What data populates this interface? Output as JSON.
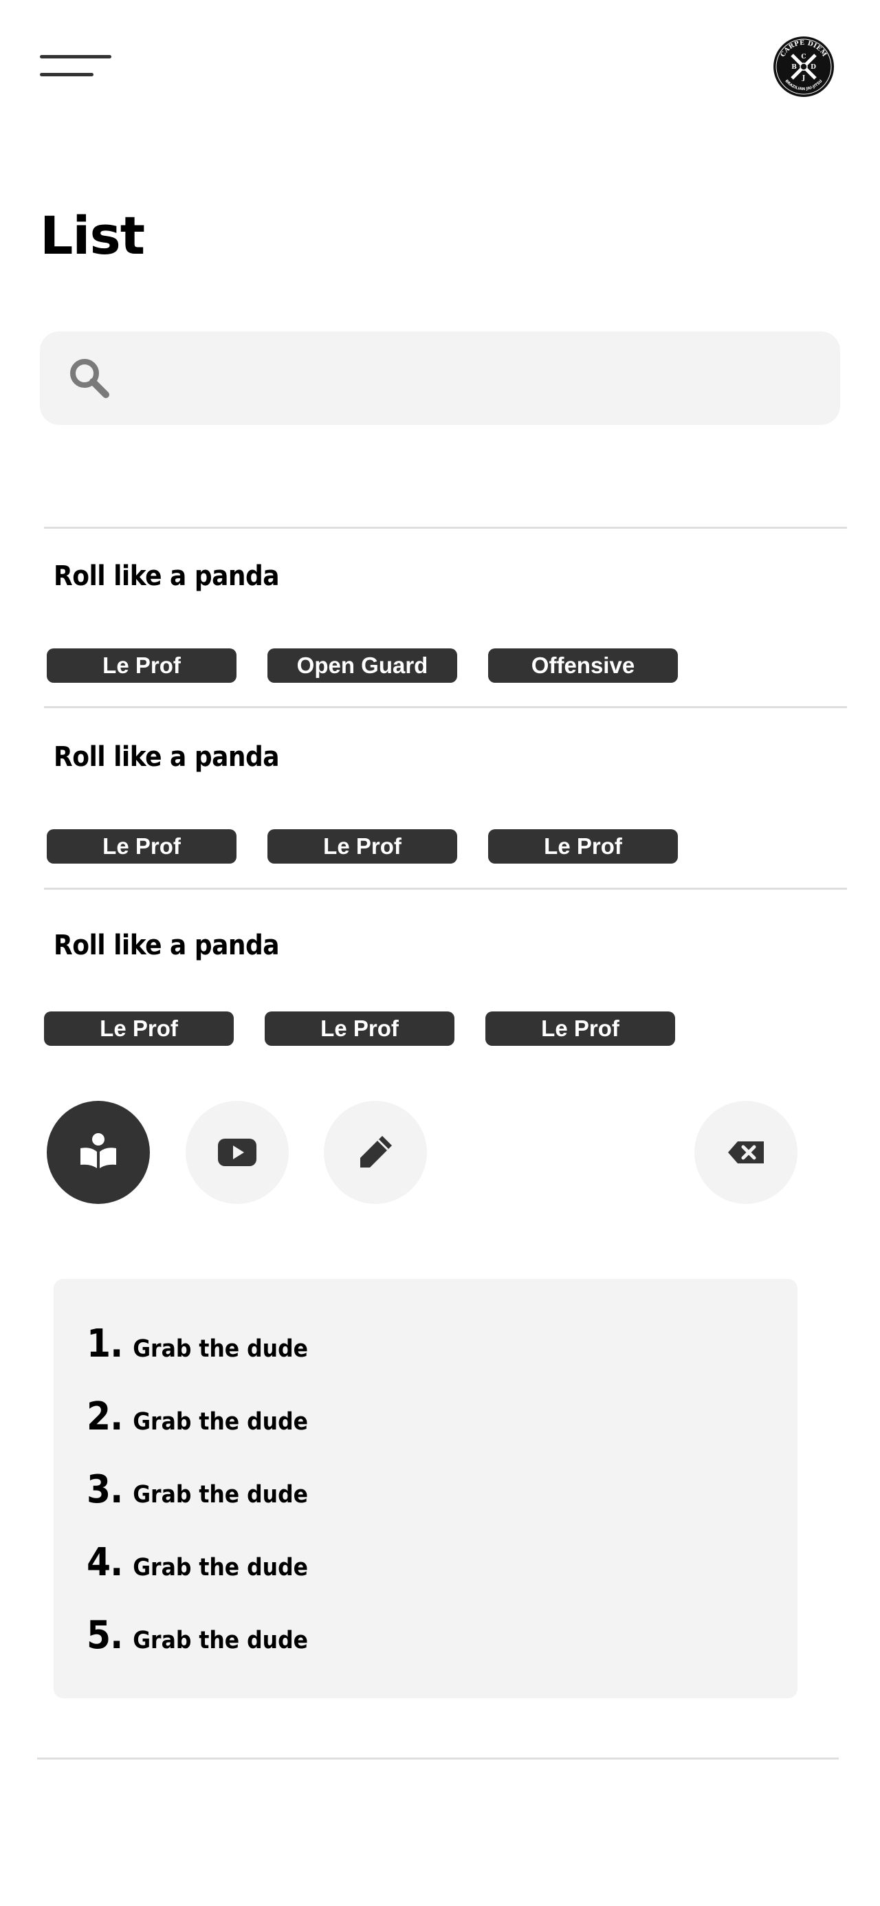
{
  "header": {
    "menu_icon": "hamburger-menu-icon",
    "logo": {
      "name": "carpe-diem-logo",
      "top_text": "CARPE DIEM",
      "bottom_text": "BRAZILIAN JIU-JITSU",
      "letters": [
        "C",
        "B",
        "D",
        "J"
      ]
    }
  },
  "page": {
    "title": "List"
  },
  "search": {
    "icon": "search-icon",
    "value": "",
    "placeholder": ""
  },
  "items": [
    {
      "title": "Roll like a panda",
      "tags": [
        "Le Prof",
        "Open Guard",
        "Offensive"
      ]
    },
    {
      "title": "Roll like a panda",
      "tags": [
        "Le Prof",
        "Le Prof",
        "Le Prof"
      ]
    },
    {
      "title": "Roll like a panda",
      "tags": [
        "Le Prof",
        "Le Prof",
        "Le Prof"
      ]
    }
  ],
  "actions": [
    {
      "name": "learn",
      "icon": "book-reader-icon",
      "active": true
    },
    {
      "name": "video",
      "icon": "youtube-icon",
      "active": false
    },
    {
      "name": "edit",
      "icon": "pencil-icon",
      "active": false
    },
    {
      "name": "delete",
      "icon": "backspace-icon",
      "active": false
    }
  ],
  "steps": [
    {
      "number": "1",
      "text": "Grab the dude"
    },
    {
      "number": "2",
      "text": "Grab the dude"
    },
    {
      "number": "3",
      "text": "Grab the dude"
    },
    {
      "number": "4",
      "text": "Grab the dude"
    },
    {
      "number": "5",
      "text": "Grab the dude"
    }
  ],
  "colors": {
    "dark": "#333333",
    "light_bg": "#f3f3f3",
    "panel_bg": "#f4f3f4",
    "divider": "#dedede"
  }
}
